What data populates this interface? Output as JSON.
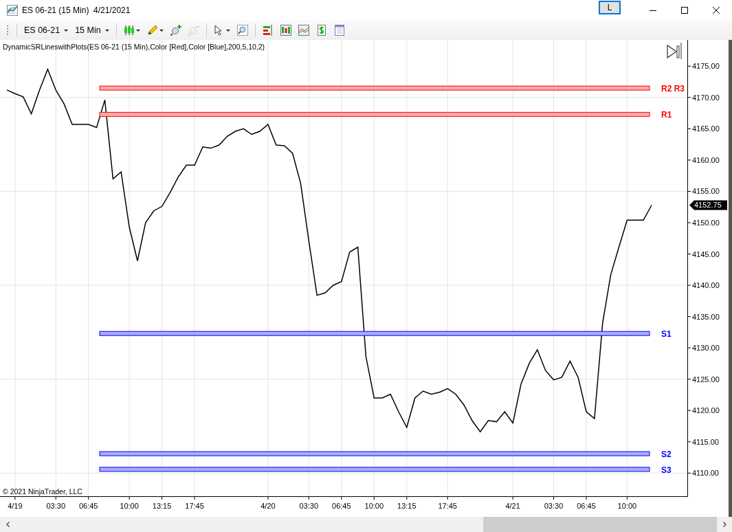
{
  "window": {
    "title": "ES 06-21 (15 Min)  4/21/2021",
    "link_button": "L"
  },
  "toolbar": {
    "instrument": "ES 06-21",
    "interval": "15 Min",
    "tools": [
      {
        "kind": "candles",
        "disabled": false
      },
      {
        "kind": "pencil",
        "disabled": false
      },
      {
        "kind": "zoom-in",
        "disabled": false
      },
      {
        "kind": "zoom-out",
        "disabled": true
      },
      {
        "kind": "pointer",
        "disabled": false
      },
      {
        "kind": "zoom-box",
        "disabled": false
      },
      {
        "kind": "data-series",
        "disabled": false
      },
      {
        "kind": "strategies",
        "disabled": false
      },
      {
        "kind": "indicators",
        "disabled": false
      },
      {
        "kind": "dollar",
        "disabled": false
      },
      {
        "kind": "properties",
        "disabled": false
      }
    ]
  },
  "chart": {
    "indicator_label": "DynamicSRLineswithPlots(ES 06-21 (15 Min),Color [Red],Color [Blue],200,5,10,2)",
    "last_price": "4152.75",
    "copyright": "© 2021 NinjaTrader, LLC",
    "levels": [
      {
        "label": "R2 R3",
        "color": "#ff0000"
      },
      {
        "label": "R1",
        "color": "#ff0000"
      },
      {
        "label": "S1",
        "color": "#0000ff"
      },
      {
        "label": "S2",
        "color": "#0000ff"
      },
      {
        "label": "S3",
        "color": "#0000ff"
      }
    ],
    "chart_data": {
      "type": "line",
      "grid": true,
      "ylim": [
        4106.3,
        4179.2
      ],
      "categories": [
        null,
        "4/19",
        null,
        null,
        null,
        null,
        "03:30",
        null,
        null,
        null,
        "06:45",
        null,
        null,
        null,
        null,
        "10:00",
        null,
        null,
        null,
        "13:15",
        null,
        null,
        null,
        "17:45",
        null,
        null,
        null,
        null,
        null,
        null,
        null,
        null,
        "4/20",
        null,
        null,
        null,
        null,
        "03:30",
        null,
        null,
        null,
        "06:45",
        null,
        null,
        null,
        "10:00",
        null,
        null,
        null,
        "13:15",
        null,
        null,
        null,
        null,
        "17:45",
        null,
        null,
        null,
        null,
        null,
        null,
        null,
        "4/21",
        null,
        null,
        null,
        null,
        "03:30",
        null,
        null,
        null,
        "06:45",
        null,
        null,
        null,
        null,
        "10:00",
        null,
        null,
        null
      ],
      "series": [
        {
          "color": "#000000",
          "values": [
            4171.2,
            4170.6,
            4170.1,
            4167.4,
            4171.2,
            4174.5,
            4171.2,
            4169.0,
            4165.7,
            4165.7,
            4165.7,
            4165.2,
            4169.6,
            4157.0,
            4158.1,
            4149.3,
            4143.9,
            4150.0,
            4151.9,
            4152.6,
            4154.8,
            4157.3,
            4159.2,
            4159.2,
            4162.1,
            4161.9,
            4162.4,
            4163.8,
            4164.6,
            4165.0,
            4164.1,
            4164.6,
            4165.7,
            4162.4,
            4162.3,
            4161.1,
            4156.3,
            4147.1,
            4138.4,
            4138.8,
            4140.0,
            4140.6,
            4145.3,
            4146.1,
            4128.6,
            4122.0,
            4122.0,
            4122.6,
            4119.8,
            4117.3,
            4122.0,
            4123.1,
            4122.6,
            4122.9,
            4123.5,
            4122.6,
            4120.9,
            4118.4,
            4116.6,
            4118.4,
            4118.2,
            4119.8,
            4118.0,
            4124.2,
            4127.5,
            4129.7,
            4126.4,
            4124.9,
            4125.3,
            4127.9,
            4125.3,
            4119.8,
            4118.7,
            4134.0,
            4141.7,
            4146.1,
            4150.4,
            4150.4,
            4150.4,
            4152.8
          ]
        }
      ],
      "yticks": [
        {
          "value": 4110,
          "label": "4110.00"
        },
        {
          "value": 4115,
          "label": "4115.00"
        },
        {
          "value": 4120,
          "label": "4120.00"
        },
        {
          "value": 4125,
          "label": "4125.00"
        },
        {
          "value": 4130,
          "label": "4130.00"
        },
        {
          "value": 4135,
          "label": "4135.00"
        },
        {
          "value": 4140,
          "label": "4140.00"
        },
        {
          "value": 4145,
          "label": "4145.00"
        },
        {
          "value": 4150,
          "label": "4150.00"
        },
        {
          "value": 4155,
          "label": "4155.00"
        },
        {
          "value": 4160,
          "label": "4160.00"
        },
        {
          "value": 4165,
          "label": "4165.00"
        },
        {
          "value": 4170,
          "label": "4170.00"
        },
        {
          "value": 4175,
          "label": "4175.00"
        }
      ]
    }
  }
}
